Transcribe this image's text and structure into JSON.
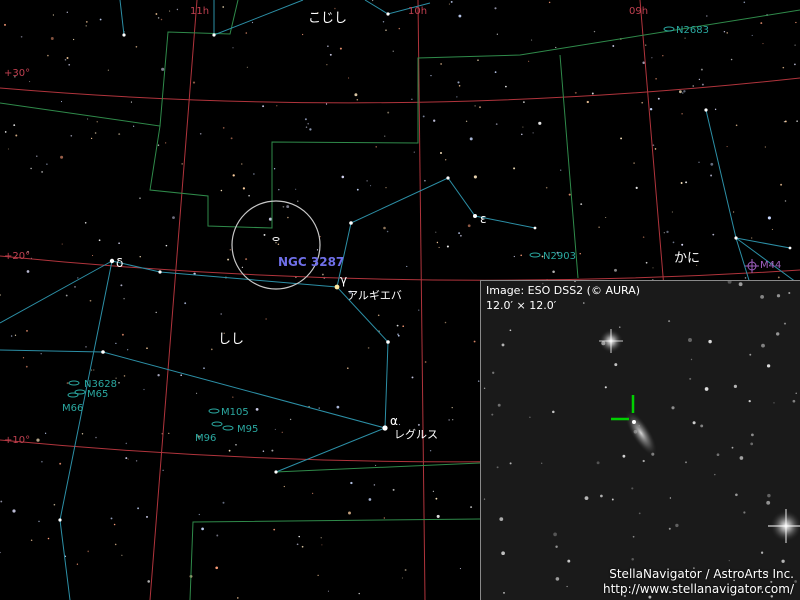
{
  "grid": {
    "ra_labels": [
      "11h",
      "10h",
      "09h"
    ],
    "dec_labels": [
      "+30°",
      "+20°",
      "+10°"
    ]
  },
  "constellations": {
    "leo_minor": "こじし",
    "leo": "しし",
    "cancer": "かに"
  },
  "stars": {
    "delta": "δ",
    "epsilon": "ε",
    "gamma": "γ",
    "gamma_name": "アルギエバ",
    "alpha": "α",
    "alpha_name": "レグルス"
  },
  "target": {
    "name": "NGC 3287"
  },
  "deep_sky": {
    "n2683": "N2683",
    "n2903": "N2903",
    "m44": "M44",
    "n3628": "N3628",
    "m65": "M65",
    "m66": "M66",
    "m105": "M105",
    "m95": "M95",
    "m96": "M96"
  },
  "inset": {
    "caption_line1": "Image: ESO DSS2 (© AURA)",
    "caption_line2": "12.0′ × 12.0′"
  },
  "credit": {
    "line1": "StellaNavigator / AstroArts Inc.",
    "line2": "http://www.stellanavigator.com/"
  },
  "colors": {
    "background": "#000000",
    "grid_line": "#b0343c",
    "boundary": "#2f8a4a",
    "figure": "#2c8fa6",
    "target_label": "#6f6fe8",
    "object_label": "#2aa8a0",
    "text": "#ffffff"
  }
}
